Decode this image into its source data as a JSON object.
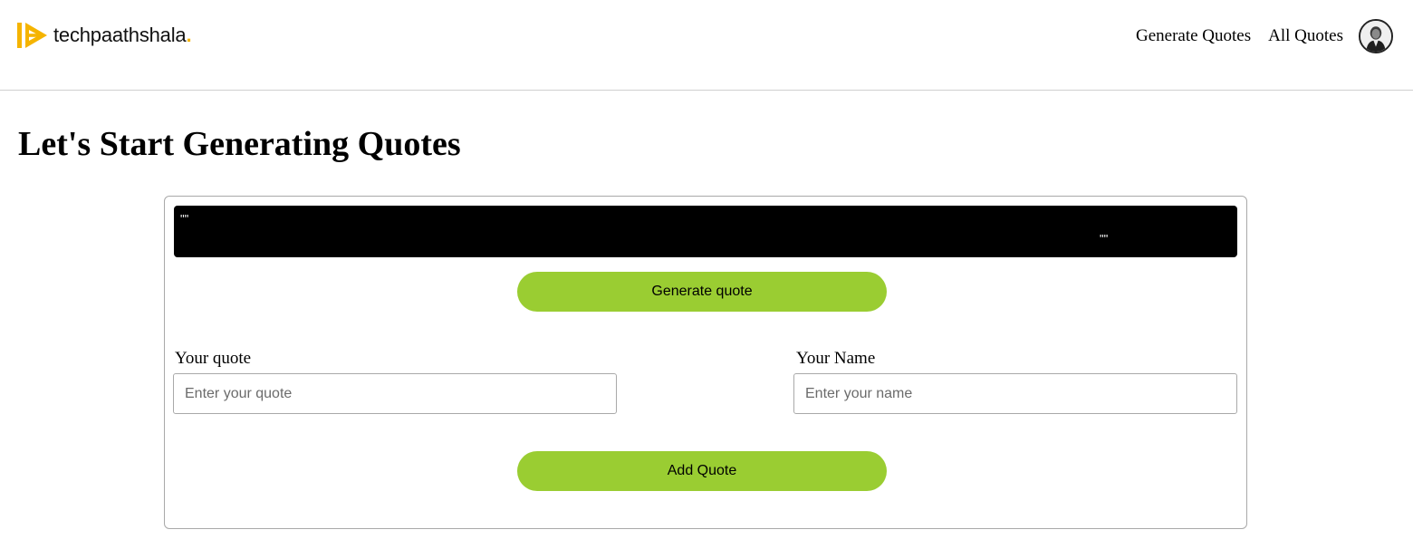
{
  "header": {
    "logo": {
      "text": "techpaathshala",
      "dot": ".",
      "accent_color": "#f5b400"
    },
    "nav": {
      "generate_quotes": "Generate Quotes",
      "all_quotes": "All Quotes",
      "avatar_icon": "user-portrait-icon"
    }
  },
  "main": {
    "title": "Let's Start Generating Quotes",
    "quote_display": {
      "open_marks": "\"\"",
      "close_marks": "\"\"",
      "background": "#000000"
    },
    "generate_button": "Generate quote",
    "form": {
      "quote_label": "Your quote",
      "quote_placeholder": "Enter your quote",
      "quote_value": "",
      "name_label": "Your Name",
      "name_placeholder": "Enter your name",
      "name_value": ""
    },
    "add_button": "Add Quote",
    "button_color": "#9acd32"
  }
}
